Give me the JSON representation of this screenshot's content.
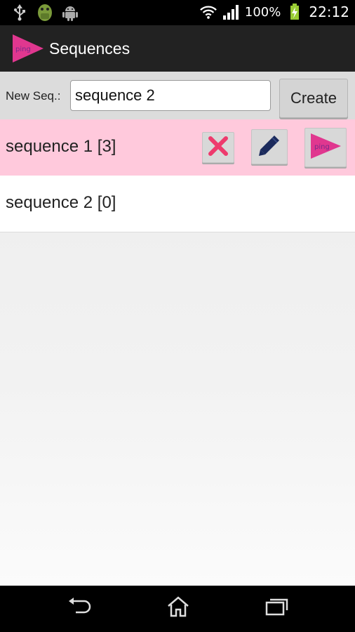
{
  "status_bar": {
    "battery": "100%",
    "time": "22:12",
    "icons": [
      "usb-icon",
      "android-debug-icon",
      "android-icon",
      "wifi-icon",
      "signal-icon",
      "battery-charging-icon"
    ]
  },
  "action_bar": {
    "icon_text": "ping",
    "title": "Sequences"
  },
  "new_sequence": {
    "label": "New Seq.:",
    "value": "sequence 2",
    "create_label": "Create"
  },
  "sequences": [
    {
      "label": "sequence 1 [3]",
      "selected": true,
      "ping_text": "ping"
    },
    {
      "label": "sequence 2 [0]",
      "selected": false
    }
  ],
  "nav_bar": {
    "icons": [
      "back-icon",
      "home-icon",
      "recent-apps-icon"
    ]
  },
  "colors": {
    "accent_pink": "#e0378f",
    "selected_row": "#ffc9dc",
    "delete_red": "#ee3a6d",
    "edit_navy": "#1b2a5c"
  }
}
